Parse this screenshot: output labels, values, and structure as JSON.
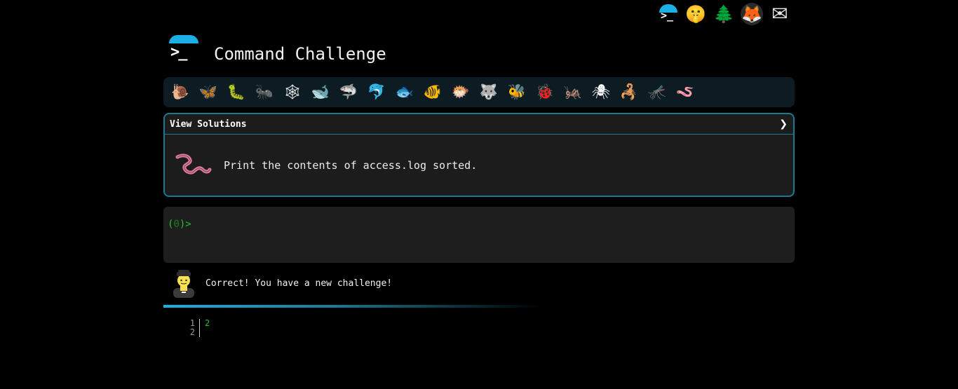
{
  "top_nav": {
    "items": [
      {
        "name": "cmdchallenge-logo-icon",
        "glyph": "",
        "prompt": ">_"
      },
      {
        "name": "shushing-face-icon",
        "glyph": "🤫"
      },
      {
        "name": "evergreen-tree-icon",
        "glyph": "🌲"
      },
      {
        "name": "gitlab-fox-icon",
        "glyph": "🦊"
      },
      {
        "name": "envelope-icon",
        "glyph": "✉"
      }
    ]
  },
  "header": {
    "logo_prompt": ">_",
    "title": "Command Challenge"
  },
  "critters": [
    "🐌",
    "🦋",
    "🐛",
    "🐜",
    "🕸",
    "🐋",
    "🦈",
    "🐬",
    "🐟",
    "🐠",
    "🐡",
    "🐺",
    "🐝",
    "🐞",
    "🦗",
    "🕷",
    "🦂",
    "🦟",
    "🪱"
  ],
  "challenge": {
    "view_solutions_label": "View Solutions",
    "expand_chevron": "❯",
    "icon_name": "worm-icon",
    "description": "Print the contents of access.log sorted."
  },
  "terminal": {
    "prompt_open": "(",
    "exit_code": "0",
    "prompt_close": ")>"
  },
  "feedback": {
    "icon_name": "judge-person-icon",
    "message": "Correct! You have a new challenge!"
  },
  "output": {
    "lines": [
      {
        "num": "1",
        "text": "2"
      },
      {
        "num": "2",
        "text": ""
      }
    ]
  },
  "colors": {
    "accent": "#1ab0e6",
    "border": "#1a7a94",
    "prompt_green": "#22c12a",
    "bar_bg": "#0d1b22"
  }
}
